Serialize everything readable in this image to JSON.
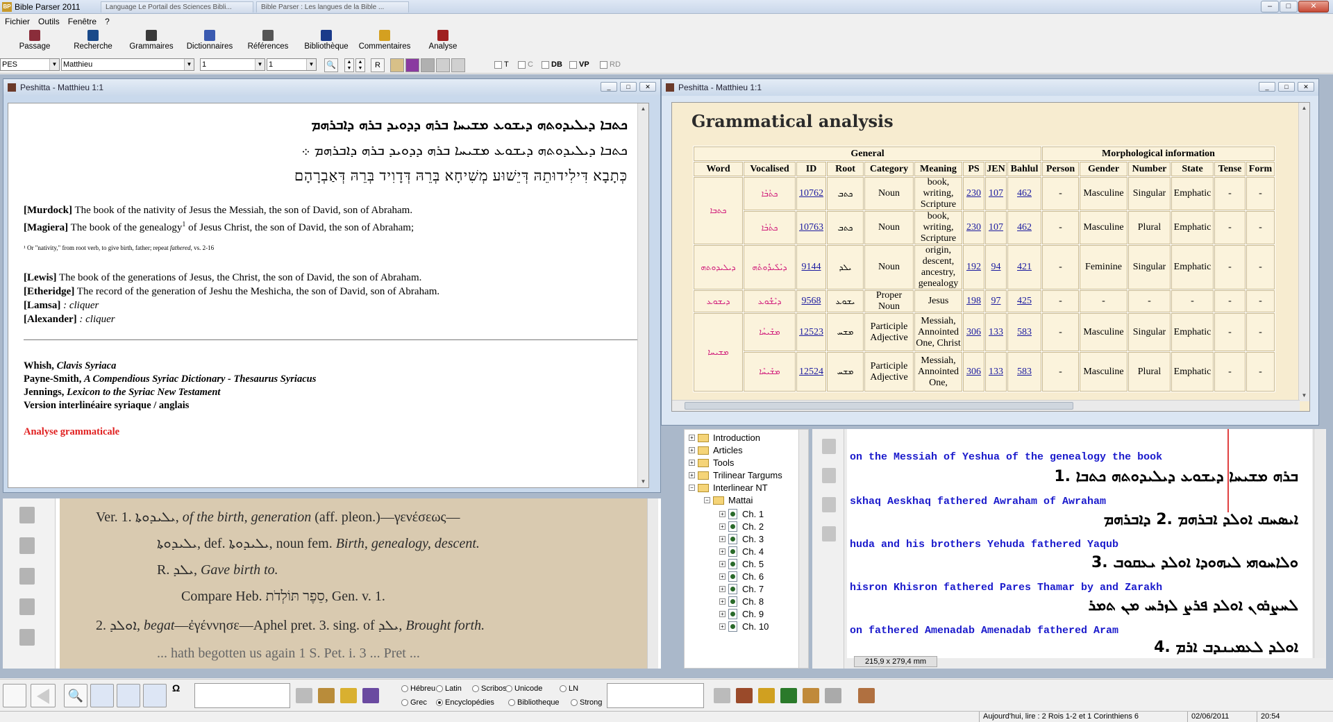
{
  "app": {
    "title": "Bible Parser 2011",
    "tabs": [
      "Language Le Portail des Sciences Bibli...",
      "Bible Parser : Les langues de la Bible ..."
    ]
  },
  "menu": [
    "Fichier",
    "Outils",
    "Fenêtre",
    "?"
  ],
  "toolbar": [
    {
      "label": "Passage",
      "icon": "book-icon",
      "color": "#8a2d3a"
    },
    {
      "label": "Recherche",
      "icon": "magnifier-icon",
      "color": "#1a4a8a"
    },
    {
      "label": "Grammaires",
      "icon": "books-icon",
      "color": "#3a3a3a"
    },
    {
      "label": "Dictionnaires",
      "icon": "dictionary-icon",
      "color": "#3a5ab0"
    },
    {
      "label": "Références",
      "icon": "references-icon",
      "color": "#555555"
    },
    {
      "label": "Bibliothèque",
      "icon": "library-icon",
      "color": "#1a3a8a"
    },
    {
      "label": "Commentaires",
      "icon": "comments-icon",
      "color": "#d4a020"
    },
    {
      "label": "Analyse",
      "icon": "analysis-icon",
      "color": "#a02020"
    }
  ],
  "selectors": {
    "version": "PES",
    "book": "Matthieu",
    "chapter": "1",
    "verse": "1"
  },
  "options": {
    "t": "T",
    "c": "C",
    "db": "DB",
    "vp": "VP",
    "rd": "RD"
  },
  "win1": {
    "title": "Peshitta - Matthieu 1:1",
    "syriac1": "ܟܬܒܐ ܕܝܠܝܕܘܬܗ ܕܝܫܘܥ ܡܫܝܚܐ ܒܪܗ ܕܕܘܝܕ ܒܪܗ ܕܐܒܪܗܡ",
    "syriac2": "ܟܬܒܐ ܕܝܠܝܕܘܬܗ ܕܝܫܘܥ ܡܫܝܚܐ ܒܪܗ ܕܕܘܝܕ ܒܪܗ ܕܐܒܪܗܡ ܀",
    "hebrew": "כְּתָבָא דִּילִידוּתֵהּ דְּיֵשׁוּע מְשִׁיחָא בְּרֵהּ דְּדָוִיד בְּרֵהּ דְּאַבְרָהָם",
    "murdock_tag": "[Murdock]",
    "murdock": " The book of the nativity of Jesus the Messiah, the son of David, son of Abraham.",
    "magiera_tag": "[Magiera]",
    "magiera_a": " The book of the genealogy",
    "magiera_sup": "1",
    "magiera_b": " of Jesus Christ, the son of David, the son of Abraham;",
    "footnote_a": "¹ Or \"nativity,\" from root verb, to give birth, father; repeat ",
    "footnote_i": "fathered",
    "footnote_b": ", vs. 2-16",
    "lewis_tag": "[Lewis]",
    "lewis": " The book of the generations of Jesus, the Christ, the son of David, the son of Abraham.",
    "etheridge_tag": "[Etheridge]",
    "etheridge": " The record of the generation of Jeshu the Meshicha, the son of David, son of Abraham.",
    "lamsa_tag": "[Lamsa]",
    "lamsa": " : cliquer",
    "alexander_tag": "[Alexander]",
    "alexander": " : cliquer",
    "whish_a": "Whish, ",
    "whish_b": "Clavis Syriaca",
    "payne_a": "Payne-Smith, ",
    "payne_b": "A Compendious Syriac Dictionary - Thesaurus Syriacus",
    "jennings_a": "Jennings, ",
    "jennings_b": "Lexicon to the Syriac New Testament",
    "version": "Version interlinéaire syriaque / anglais",
    "analyse": "Analyse grammaticale",
    "analyse_color": "#e02020"
  },
  "win2": {
    "title": "Peshitta - Matthieu 1:1",
    "heading": "Grammatical analysis",
    "groups": {
      "general": "General",
      "morph": "Morphological information"
    },
    "headers": [
      "Word",
      "Vocalised",
      "ID",
      "Root",
      "Category",
      "Meaning",
      "PS",
      "JEN",
      "Bahlul",
      "Person",
      "Gender",
      "Number",
      "State",
      "Tense",
      "Form"
    ],
    "rows": [
      {
        "word": "ܟܬܒܐ",
        "voc": "ܟܬܳܒܳܐ",
        "id": "10762",
        "root": "ܟܬܒ",
        "cat": "Noun",
        "mean": "book, writing, Scripture",
        "ps": "230",
        "jen": "107",
        "bah": "462",
        "person": "-",
        "gender": "Masculine",
        "number": "Singular",
        "state": "Emphatic",
        "tense": "-",
        "form": "-"
      },
      {
        "word": "",
        "voc": "ܟܬܳܒܳܐ",
        "id": "10763",
        "root": "ܟܬܒ",
        "cat": "Noun",
        "mean": "book, writing, Scripture",
        "ps": "230",
        "jen": "107",
        "bah": "462",
        "person": "-",
        "gender": "Masculine",
        "number": "Plural",
        "state": "Emphatic",
        "tense": "-",
        "form": "-"
      },
      {
        "word": "ܕܝܠܝܕܘܬܗ",
        "voc": "ܕܝܺܠܺܝܕܽܘܬܶܗ",
        "id": "9144",
        "root": "ܝܠܕ",
        "cat": "Noun",
        "mean": "origin, descent, ancestry, genealogy",
        "ps": "192",
        "jen": "94",
        "bah": "421",
        "person": "-",
        "gender": "Feminine",
        "number": "Singular",
        "state": "Emphatic",
        "tense": "-",
        "form": "-"
      },
      {
        "word": "ܕܝܫܘܥ",
        "voc": "ܕܝܶܫܽܘܥ",
        "id": "9568",
        "root": "ܝܫܘܥ",
        "cat": "Proper Noun",
        "mean": "Jesus",
        "ps": "198",
        "jen": "97",
        "bah": "425",
        "person": "-",
        "gender": "-",
        "number": "-",
        "state": "-",
        "tense": "-",
        "form": "-"
      },
      {
        "word": "ܡܫܝܚܐ",
        "voc": "ܡܫܺܝܚܳܐ",
        "id": "12523",
        "root": "ܡܫܚ",
        "cat": "Participle Adjective",
        "mean": "Messiah, Annointed One, Christ",
        "ps": "306",
        "jen": "133",
        "bah": "583",
        "person": "-",
        "gender": "Masculine",
        "number": "Singular",
        "state": "Emphatic",
        "tense": "-",
        "form": "-"
      },
      {
        "word": "",
        "voc": "ܡܫܺܝܚܶܐ",
        "id": "12524",
        "root": "ܡܫܚ",
        "cat": "Participle Adjective",
        "mean": "Messiah, Annointed One,",
        "ps": "306",
        "jen": "133",
        "bah": "583",
        "person": "-",
        "gender": "Masculine",
        "number": "Plural",
        "state": "Emphatic",
        "tense": "-",
        "form": "-"
      }
    ]
  },
  "pdf": {
    "l1a": "Ver. 1.  ܝܠܝܕܘܬܐ,",
    "l1b": " of the birth, generation",
    "l1c": " (aff. pleon.)—γενέσεως—",
    "l2a": "ܝܠܝܕܘܬܐ, def. ܝܠܝܕܘܬܐ, noun fem.",
    "l2b": " Birth, genealogy, descent.",
    "l3a": "R. ܝܠܕ,",
    "l3b": " Gave birth to.",
    "l4": "Compare Heb. סֵפֶר תּוֹלְדֹת, Gen. v. 1.",
    "l5a": "2.  ܐܘܠܕ,",
    "l5b": " begat",
    "l5c": "—ἐγέννησε—Aphel pret. 3. sing. of ܝܠܕ,",
    "l5d": " Brought forth.",
    "l6": "... hath begotten us again 1 S. Pet. i. 3 ... Pret ..."
  },
  "tree": {
    "folders": [
      "Introduction",
      "Articles",
      "Tools",
      "Trilinear Targums",
      "Interlinear NT",
      "Mattai"
    ],
    "chapters": [
      "Ch. 1",
      "Ch. 2",
      "Ch. 3",
      "Ch. 4",
      "Ch. 5",
      "Ch. 6",
      "Ch. 7",
      "Ch. 8",
      "Ch. 9",
      "Ch. 10"
    ]
  },
  "interlinear": {
    "e1": "on  the Messiah  of Yeshua  of the genealogy  the book",
    "s1": "ܒܪܗ  ܡܫܝܚܐ  ܕܝܫܘܥ  ܕܝܠܝܕܘܬܗ  ܟܬܒܐ  .1",
    "e2": "skhaq    Aeskhaq   fathered   Awraham      of Awraham",
    "s2": "ܐܝܣܚܩ  ܐܘܠܕ  ܐܒܪܗܡ  .2  ܕܐܒܪܗܡ",
    "e3": "huda      and his brothers   Yehuda    fathered   Yaqub",
    "s3": "ܘܠܐܚܘܗܝ  ܠܝܗܘܕܐ  ܐܘܠܕ  ܝܥܩܘܒ  .3",
    "e4": "hisron    Khisron   fathered Pares  Thamar   by  and Zarakh",
    "s4": "ܠܚܨܪܘܢ  ܐܘܠܕ  ܦܪܨ  ܠܙܪܚ  ܡܢ  ܬܡܪ",
    "e5": "on   fathered   Amenadab     Amenadab   fathered   Aram",
    "s5": "ܐܘܠܕ  ܠܥܡܝܢܕܒ  ܐܪܡ  .4",
    "pagesize": "215,9 x 279,4 mm"
  },
  "bottom": {
    "radios1": [
      {
        "label": "Hébreu",
        "on": false
      },
      {
        "label": "Latin",
        "on": false
      },
      {
        "label": "Scribos",
        "on": false
      },
      {
        "label": "Unicode",
        "on": false
      },
      {
        "label": "LN",
        "on": false
      }
    ],
    "radios2": [
      {
        "label": "Grec",
        "on": false
      },
      {
        "label": "Encyclopédies",
        "on": true
      },
      {
        "label": "Bibliotheque",
        "on": false
      },
      {
        "label": "Strong",
        "on": false
      }
    ]
  },
  "status": {
    "reading": "Aujourd'hui, lire : 2 Rois 1-2 et 1 Corinthiens 6",
    "date": "02/06/2011",
    "time": "20:54"
  }
}
